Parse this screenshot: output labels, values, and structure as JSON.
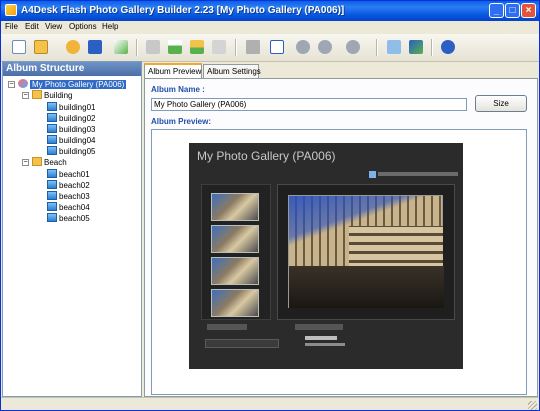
{
  "window": {
    "title": "A4Desk Flash Photo Gallery Builder  2.23  [My Photo Gallery (PA006)]"
  },
  "menu": [
    "File",
    "Edit",
    "View",
    "Options",
    "Help"
  ],
  "toolbar": {
    "icons": [
      "new-icon",
      "open-icon",
      "reload-icon",
      "save-icon",
      "export-icon",
      "add-album-icon",
      "add-image-icon",
      "add-folder-icon",
      "properties-icon",
      "delete-icon",
      "rename-icon",
      "move-up-icon",
      "move-down-icon",
      "navigate-icon",
      "preview-icon",
      "publish-icon",
      "help-icon"
    ]
  },
  "left_panel": {
    "header": "Album Structure",
    "root": "My Photo Gallery (PA006)",
    "folders": [
      {
        "name": "Building",
        "items": [
          "building01",
          "building02",
          "building03",
          "building04",
          "building05"
        ]
      },
      {
        "name": "Beach",
        "items": [
          "beach01",
          "beach02",
          "beach03",
          "beach04",
          "beach05"
        ]
      }
    ]
  },
  "tabs": [
    "Album Preview",
    "Album Settings"
  ],
  "album": {
    "name_label": "Album Name :",
    "name_value": "My Photo Gallery (PA006)",
    "size_button": "Size",
    "preview_label": "Album Preview:"
  },
  "gallery_preview": {
    "title": "My Photo Gallery (PA006)"
  },
  "colors": {
    "title_bar": "#0a5fe8",
    "accent_label": "#1f4fa5",
    "selection": "#316ac5"
  }
}
